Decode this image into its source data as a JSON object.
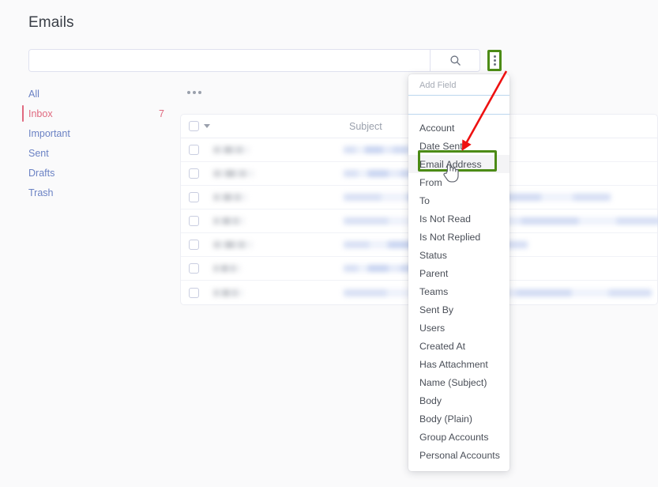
{
  "page": {
    "title": "Emails"
  },
  "search": {
    "value": "",
    "placeholder": "",
    "button_icon": "search-icon"
  },
  "toolbar": {
    "kebab_icon": "more-vertical-icon",
    "list_ellipsis_icon": "more-horizontal-icon"
  },
  "sidebar": {
    "items": [
      {
        "label": "All",
        "count": "",
        "active": false
      },
      {
        "label": "Inbox",
        "count": "7",
        "active": true
      },
      {
        "label": "Important",
        "count": "",
        "active": false
      },
      {
        "label": "Sent",
        "count": "",
        "active": false
      },
      {
        "label": "Drafts",
        "count": "",
        "active": false
      },
      {
        "label": "Trash",
        "count": "",
        "active": false
      }
    ]
  },
  "table": {
    "columns": {
      "select_all": "select-all-checkbox",
      "subject": "Subject"
    },
    "rows": [
      {
        "from": "",
        "subject": ""
      },
      {
        "from": "",
        "subject": ""
      },
      {
        "from": "",
        "subject": ""
      },
      {
        "from": "",
        "subject": ""
      },
      {
        "from": "",
        "subject": ""
      },
      {
        "from": "",
        "subject": ""
      },
      {
        "from": "",
        "subject": ""
      }
    ]
  },
  "dropdown": {
    "title": "Add Field",
    "filter_value": "",
    "filter_placeholder": "",
    "highlighted_item": "Email Address",
    "items": [
      "Account",
      "Date Sent",
      "Email Address",
      "From",
      "To",
      "Is Not Read",
      "Is Not Replied",
      "Status",
      "Parent",
      "Teams",
      "Sent By",
      "Users",
      "Created At",
      "Has Attachment",
      "Name (Subject)",
      "Body",
      "Body (Plain)",
      "Group Accounts",
      "Personal Accounts"
    ]
  },
  "annotations": {
    "highlight_color": "#4c8b16",
    "arrow_color": "#ee1111",
    "cursor_icon": "pointing-hand-cursor"
  },
  "colors": {
    "background": "#fafafb",
    "link": "#6b82c4",
    "active": "#e0697f",
    "border": "#edeef4"
  }
}
